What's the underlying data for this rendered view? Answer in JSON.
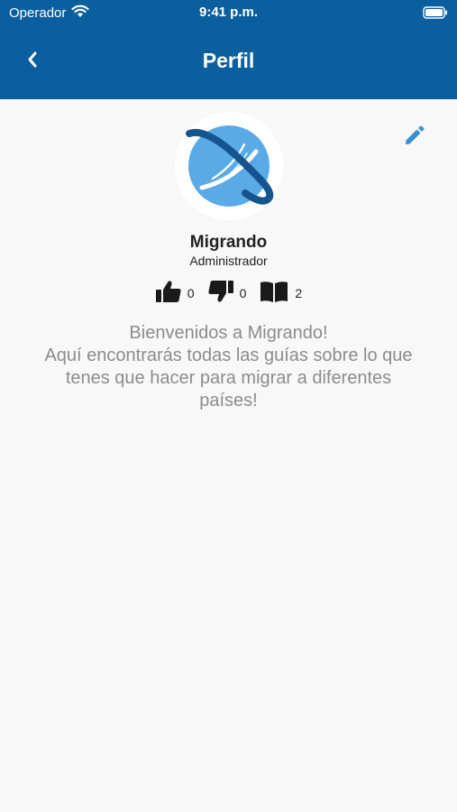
{
  "status_bar": {
    "carrier": "Operador",
    "time": "9:41 p.m."
  },
  "header": {
    "title": "Perfil"
  },
  "profile": {
    "name": "Migrando",
    "role": "Administrador",
    "stats": {
      "likes": "0",
      "dislikes": "0",
      "guides": "2"
    },
    "welcome_lines": [
      "Bienvenidos a Migrando!",
      "Aquí encontrarás todas las guías sobre lo que",
      "tenes que hacer para migrar a diferentes",
      "países!"
    ]
  },
  "icons": {
    "back": "chevron-left-icon",
    "edit": "pencil-icon",
    "like": "thumbs-up-icon",
    "dislike": "thumbs-down-icon",
    "guides": "book-icon"
  },
  "colors": {
    "header_bg": "#0b5f9e",
    "accent": "#3d8fd4",
    "logo_light": "#5aaae8",
    "logo_dark": "#14548f",
    "page_bg": "#f8f8f8"
  }
}
